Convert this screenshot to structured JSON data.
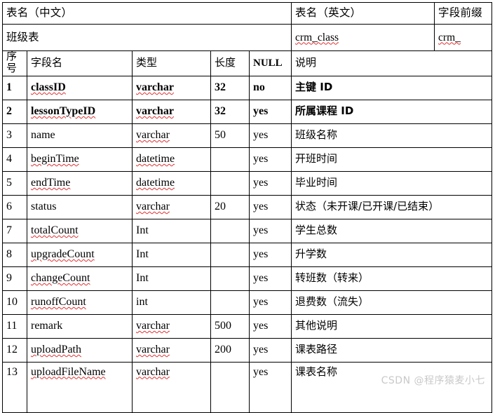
{
  "document": {
    "title": "crm_class",
    "watermark": "CSDN @程序猿麦小七"
  },
  "meta": {
    "labels": {
      "table_name_cn": "表名（中文）",
      "table_name_en": "表名（英文）",
      "field_prefix": "字段前缀"
    },
    "values": {
      "table_name_cn": "班级表",
      "table_name_en": "crm_class",
      "field_prefix": "crm_"
    }
  },
  "columns": {
    "index": "序号",
    "field": "字段名",
    "type": "类型",
    "length": "长度",
    "nullable": "NULL",
    "description": "说明"
  },
  "rows": [
    {
      "index": "1",
      "field": "classID",
      "type": "varchar",
      "length": "32",
      "nullable": "no",
      "description": "主键 ID",
      "bold": true
    },
    {
      "index": "2",
      "field": "lessonTypeID",
      "type": "varchar",
      "length": "32",
      "nullable": "yes",
      "description": "所属课程 ID",
      "bold": true
    },
    {
      "index": "3",
      "field": "name",
      "type": "varchar",
      "length": "50",
      "nullable": "yes",
      "description": "班级名称",
      "bold": false
    },
    {
      "index": "4",
      "field": "beginTime",
      "type": "datetime",
      "length": "",
      "nullable": "yes",
      "description": "开班时间",
      "bold": false
    },
    {
      "index": "5",
      "field": "endTime",
      "type": "datetime",
      "length": "",
      "nullable": "yes",
      "description": "毕业时间",
      "bold": false
    },
    {
      "index": "6",
      "field": "status",
      "type": "varchar",
      "length": "20",
      "nullable": "yes",
      "description": "状态（未开课/已开课/已结束）",
      "bold": false
    },
    {
      "index": "7",
      "field": "totalCount",
      "type": "Int",
      "length": "",
      "nullable": "yes",
      "description": "学生总数",
      "bold": false
    },
    {
      "index": "8",
      "field": "upgradeCount",
      "type": "Int",
      "length": "",
      "nullable": "yes",
      "description": "升学数",
      "bold": false
    },
    {
      "index": "9",
      "field": "changeCount",
      "type": "Int",
      "length": "",
      "nullable": "yes",
      "description": "转班数（转来）",
      "bold": false
    },
    {
      "index": "10",
      "field": "runoffCount",
      "type": "int",
      "length": "",
      "nullable": "yes",
      "description": "退费数（流失）",
      "bold": false
    },
    {
      "index": "11",
      "field": "remark",
      "type": "varchar",
      "length": "500",
      "nullable": "yes",
      "description": "其他说明",
      "bold": false
    },
    {
      "index": "12",
      "field": "uploadPath",
      "type": "varchar",
      "length": "200",
      "nullable": "yes",
      "description": "课表路径",
      "bold": false
    },
    {
      "index": "13",
      "field": "uploadFileName",
      "type": "varchar",
      "length": "",
      "nullable": "yes",
      "description": "课表名称",
      "bold": false
    }
  ],
  "colors": {
    "header_background": "#c0c0c0",
    "border": "#000000",
    "text": "#000000",
    "spellcheck_underline": "#e03030",
    "watermark": "#c9c9c9"
  }
}
